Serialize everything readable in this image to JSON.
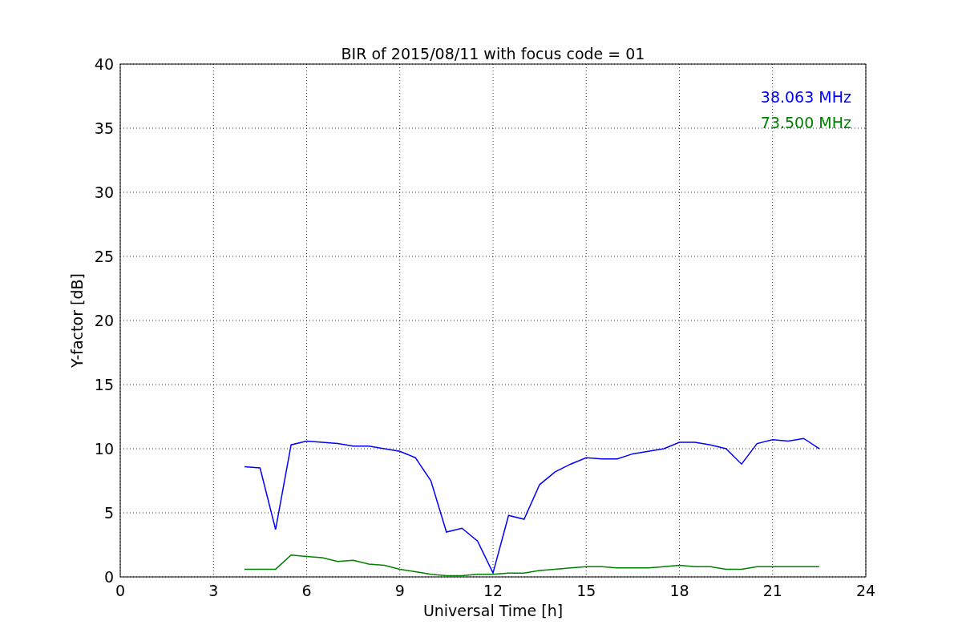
{
  "chart_data": {
    "type": "line",
    "title": "BIR of 2015/08/11 with focus code = 01",
    "xlabel": "Universal Time [h]",
    "ylabel": "Y-factor [dB]",
    "xlim": [
      0,
      24
    ],
    "ylim": [
      0,
      40
    ],
    "xticks": [
      0,
      3,
      6,
      9,
      12,
      15,
      18,
      21,
      24
    ],
    "yticks": [
      0,
      5,
      10,
      15,
      20,
      25,
      30,
      35,
      40
    ],
    "grid": true,
    "x": [
      4.0,
      4.5,
      5.0,
      5.5,
      6.0,
      6.5,
      7.0,
      7.5,
      8.0,
      8.5,
      9.0,
      9.5,
      10.0,
      10.5,
      11.0,
      11.5,
      12.0,
      12.5,
      13.0,
      13.5,
      14.0,
      14.5,
      15.0,
      15.5,
      16.0,
      16.5,
      17.0,
      17.5,
      18.0,
      18.5,
      19.0,
      19.5,
      20.0,
      20.5,
      21.0,
      21.5,
      22.0,
      22.5
    ],
    "series": [
      {
        "name": "38.063 MHz",
        "color": "#0000ff",
        "values": [
          8.6,
          8.5,
          3.7,
          10.3,
          10.6,
          10.5,
          10.4,
          10.2,
          10.2,
          10.0,
          9.8,
          9.3,
          7.5,
          3.5,
          3.8,
          2.8,
          0.3,
          4.8,
          4.5,
          7.2,
          8.2,
          8.8,
          9.3,
          9.2,
          9.2,
          9.6,
          9.8,
          10.0,
          10.5,
          10.5,
          10.3,
          10.0,
          8.8,
          10.4,
          10.7,
          10.6,
          10.8,
          10.0
        ]
      },
      {
        "name": "73.500 MHz",
        "color": "#008000",
        "values": [
          0.6,
          0.6,
          0.6,
          1.7,
          1.6,
          1.5,
          1.2,
          1.3,
          1.0,
          0.9,
          0.6,
          0.4,
          0.2,
          0.1,
          0.1,
          0.2,
          0.2,
          0.3,
          0.3,
          0.5,
          0.6,
          0.7,
          0.8,
          0.8,
          0.7,
          0.7,
          0.7,
          0.8,
          0.9,
          0.8,
          0.8,
          0.6,
          0.6,
          0.8,
          0.8,
          0.8,
          0.8,
          0.8
        ]
      }
    ]
  }
}
